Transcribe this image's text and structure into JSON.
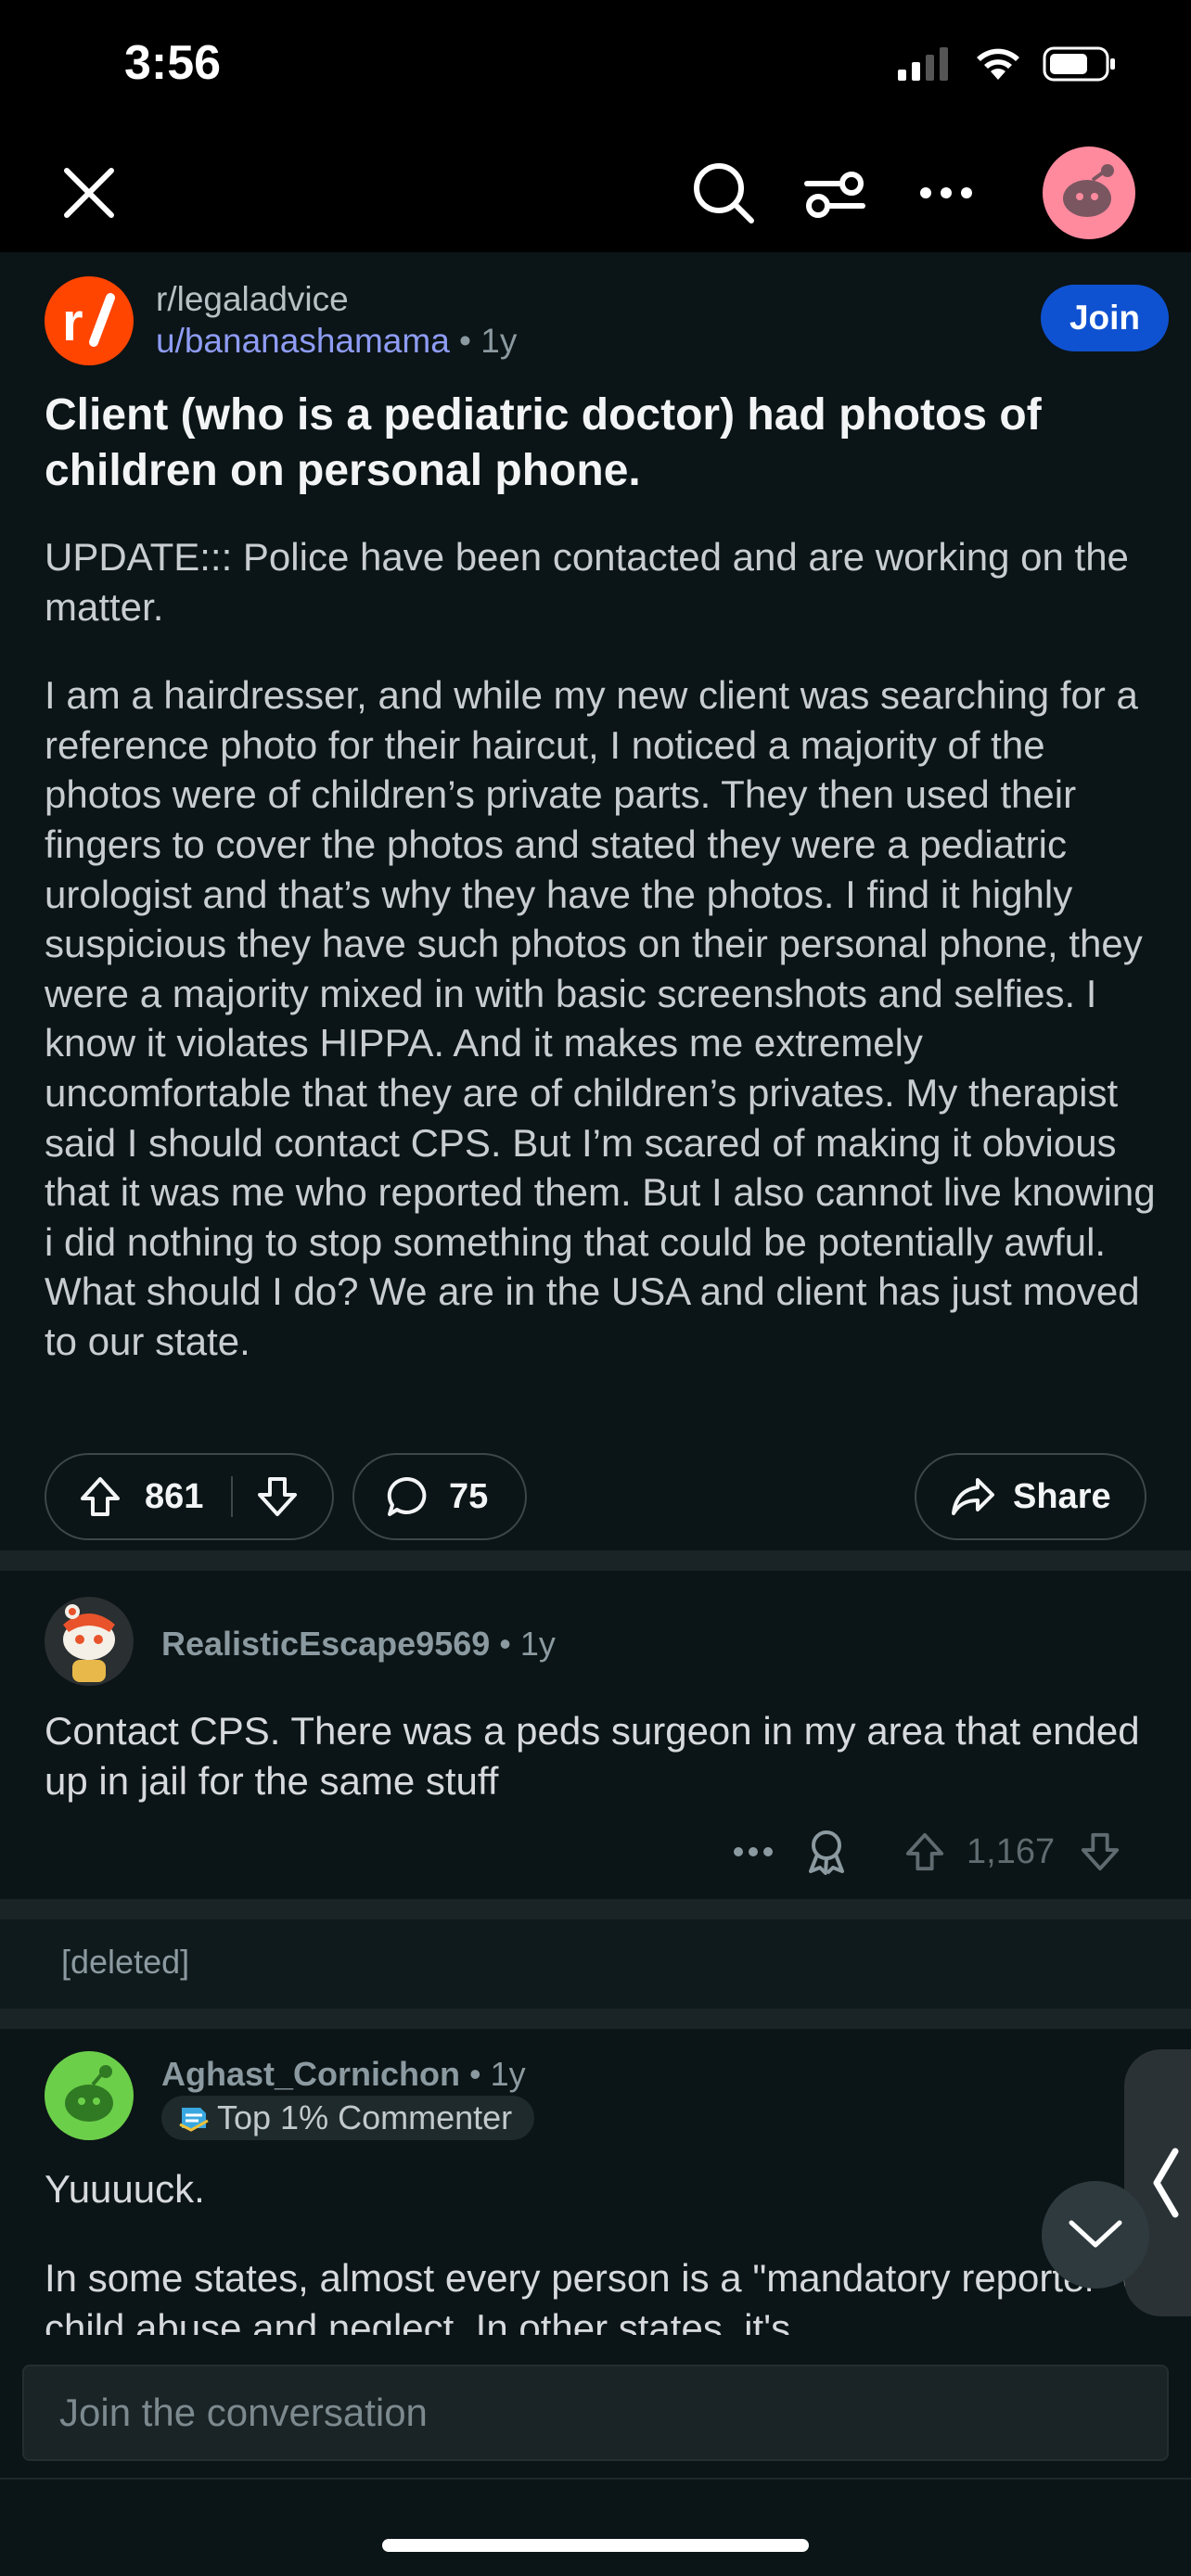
{
  "status_bar": {
    "time": "3:56"
  },
  "post": {
    "subreddit": "r/legaladvice",
    "author": "u/bananashamama",
    "age": "1y",
    "join_label": "Join",
    "title": "Client (who is a pediatric doctor) had photos of children on personal phone.",
    "update": "UPDATE::: Police have been contacted and are working on the matter.",
    "body": "I am a hairdresser, and while my new client was searching for a reference photo for their haircut, I noticed a majority of the photos were of children’s private parts. They then used their fingers to cover the photos and stated they were a pediatric urologist and that’s why they have the photos. I find it highly suspicious they have such photos on their personal phone, they were a majority mixed in with basic screenshots and selfies. I know it violates HIPPA. And it makes me extremely uncomfortable that they are of children’s privates. My therapist said I should contact CPS. But I’m scared of making it obvious that it was me who reported them. But I also cannot live knowing i did nothing to stop something that could be potentially awful. What should I do? We are in the USA and client has just moved to our state.",
    "upvotes": "861",
    "comments": "75",
    "share_label": "Share"
  },
  "comments": [
    {
      "user": "RealisticEscape9569",
      "age": "1y",
      "text": "Contact CPS. There was a peds surgeon in my area that ended up in jail for the same stuff",
      "votes": "1,167"
    },
    {
      "deleted_label": "[deleted]"
    },
    {
      "user": "Aghast_Cornichon",
      "age": "1y",
      "badge": "Top 1% Commenter",
      "text1": "Yuuuuck.",
      "text2": "In some states, almost every person is a \"mandatory reporter\" of child abuse and neglect. In other states, it's"
    }
  ],
  "composer": {
    "placeholder": "Join the conversation"
  },
  "colors": {
    "background": "#0b1416",
    "join": "#0f52d1",
    "subreddit_icon": "#ff4500",
    "author_link": "#8e9cf5"
  }
}
